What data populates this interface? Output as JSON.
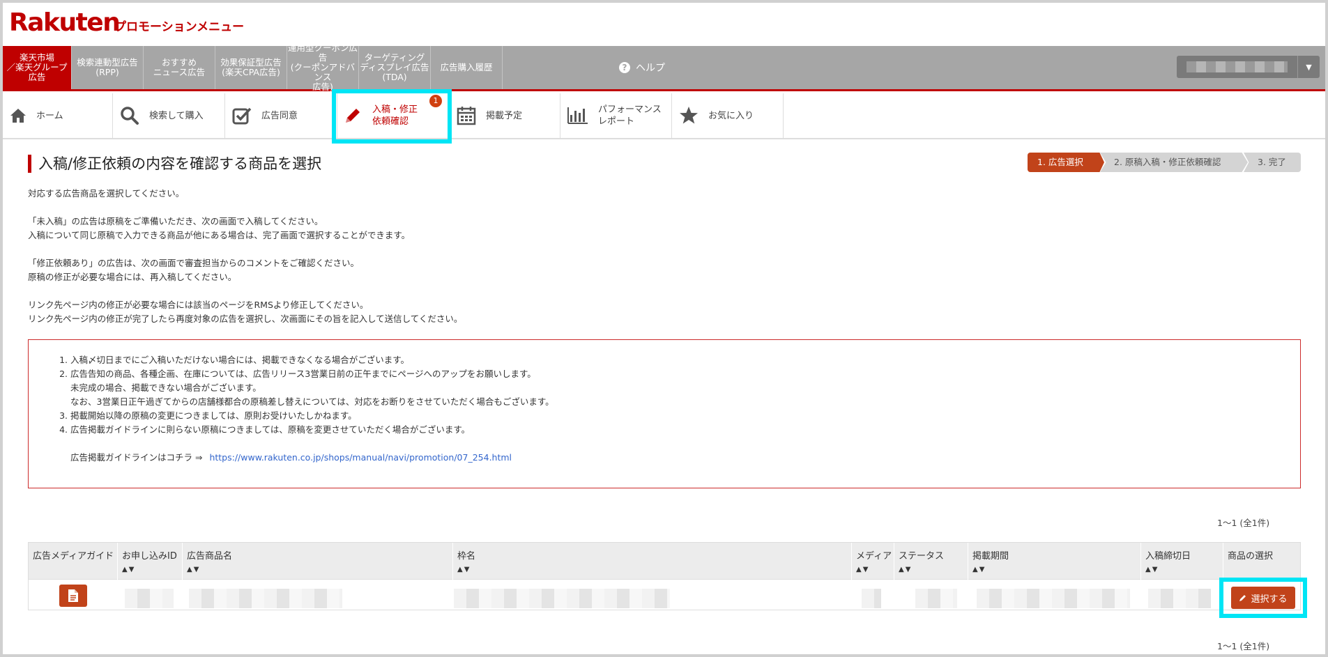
{
  "header": {
    "logo": "Rakuten",
    "subtitle": "プロモーションメニュー"
  },
  "main_nav": {
    "items": [
      {
        "label": "楽天市場\n／楽天グループ広告"
      },
      {
        "label": "検索連動型広告\n(RPP)"
      },
      {
        "label": "おすすめ\nニュース広告"
      },
      {
        "label": "効果保証型広告\n(楽天CPA広告)"
      },
      {
        "label": "運用型クーポン広告\n(クーポンアドバンス\n広告)"
      },
      {
        "label": "ターゲティング\nディスプレイ広告\n(TDA)"
      },
      {
        "label": "広告購入履歴"
      }
    ],
    "help": "ヘルプ"
  },
  "sub_nav": {
    "items": [
      {
        "label": "ホーム"
      },
      {
        "label": "検索して購入"
      },
      {
        "label": "広告同意"
      },
      {
        "label": "入稿・修正\n依頼確認",
        "badge": "1"
      },
      {
        "label": "掲載予定"
      },
      {
        "label": "パフォーマンス\nレポート"
      },
      {
        "label": "お気に入り"
      }
    ]
  },
  "page": {
    "title": "入稿/修正依頼の内容を確認する商品を選択",
    "steps": [
      "1. 広告選択",
      "2. 原稿入稿・修正依頼確認",
      "3. 完了"
    ],
    "intro": [
      "対応する広告商品を選択してください。",
      "「未入稿」の広告は原稿をご準備いただき、次の画面で入稿してください。",
      "入稿について同じ原稿で入力できる商品が他にある場合は、完了画面で選択することができます。",
      "「修正依頼あり」の広告は、次の画面で審査担当からのコメントをご確認ください。",
      "原稿の修正が必要な場合には、再入稿してください。",
      "リンク先ページ内の修正が必要な場合には該当のページをRMSより修正してください。",
      "リンク先ページ内の修正が完了したら再度対象の広告を選択し、次画面にその旨を記入して送信してください。"
    ]
  },
  "notice": {
    "items": [
      "入稿〆切日までにご入稿いただけない場合には、掲載できなくなる場合がございます。",
      "広告告知の商品、各種企画、在庫については、広告リリース3営業日前の正午までにページへのアップをお願いします。",
      "掲載開始以降の原稿の変更につきましては、原則お受けいたしかねます。",
      "広告掲載ガイドラインに則らない原稿につきましては、原稿を変更させていただく場合がございます。"
    ],
    "item2_sub1": "未完成の場合、掲載できない場合がございます。",
    "item2_sub2": "なお、3営業日正午過ぎてからの店舗様都合の原稿差し替えについては、対応をお断りをさせていただく場合もございます。",
    "guide_label": "広告掲載ガイドラインはコチラ ⇒",
    "guide_url": "https://www.rakuten.co.jp/shops/manual/navi/promotion/07_254.html"
  },
  "table": {
    "count_top": "1～1 (全1件)",
    "count_bottom": "1～1 (全1件)",
    "headers": [
      "広告メディアガイド",
      "お申し込みID",
      "広告商品名",
      "枠名",
      "メディア",
      "ステータス",
      "掲載期間",
      "入稿締切日",
      "商品の選択"
    ],
    "sort_arrows": "▲▼",
    "select_label": "選択する"
  },
  "colors": {
    "brand": "#bf0000",
    "accent": "#c1431a",
    "highlight": "#00e5f5",
    "nav_gray": "#a6a6a6"
  }
}
